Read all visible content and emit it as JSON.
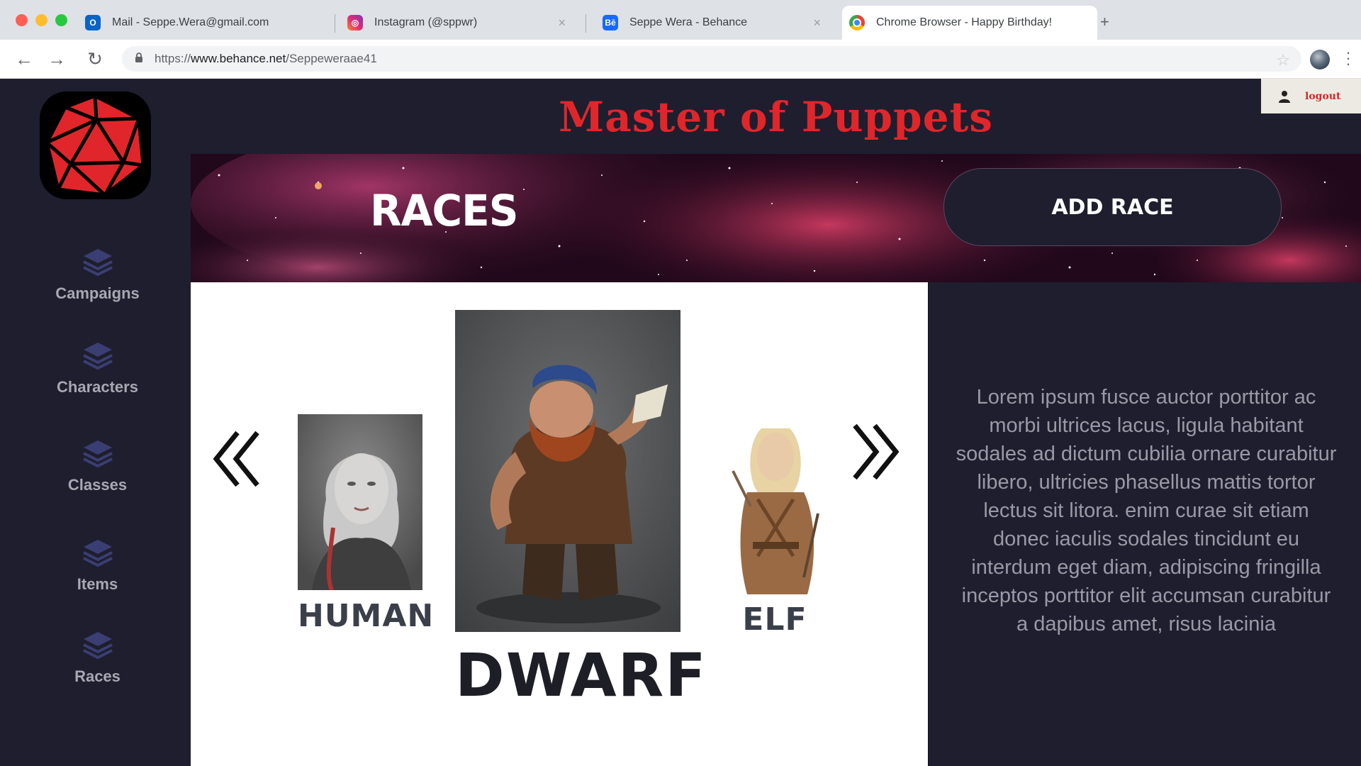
{
  "browser": {
    "tabs": [
      {
        "label": "Mail - Seppe.Wera@gmail.com",
        "icon": "outlook-icon",
        "active": false
      },
      {
        "label": "Instagram (@sppwr)",
        "icon": "instagram-icon",
        "active": false
      },
      {
        "label": "Seppe Wera - Behance",
        "icon": "behance-icon",
        "active": false
      },
      {
        "label": "Chrome Browser - Happy Birthday!",
        "icon": "chrome-icon",
        "active": true
      }
    ],
    "url": {
      "scheme": "https://",
      "domain": "www.behance.net",
      "path": "/Seppeweraae41"
    }
  },
  "app": {
    "title": "Master of Puppets",
    "logout_label": "logout",
    "sidebar": {
      "items": [
        {
          "label": "Campaigns",
          "icon": "stack-icon"
        },
        {
          "label": "Characters",
          "icon": "stack-icon"
        },
        {
          "label": "Classes",
          "icon": "stack-icon"
        },
        {
          "label": "Items",
          "icon": "stack-icon"
        },
        {
          "label": "Races",
          "icon": "stack-icon"
        }
      ]
    },
    "banner": {
      "title": "RACES",
      "add_button": "ADD RACE"
    },
    "carousel": {
      "prev_icon": "double-chevron-left-icon",
      "next_icon": "double-chevron-right-icon",
      "left": {
        "label": "HUMAN"
      },
      "center": {
        "label": "DWARF"
      },
      "right": {
        "label": "ELF"
      }
    },
    "description": "Lorem ipsum fusce auctor porttitor ac morbi ultrices lacus, ligula habitant sodales ad dictum cubilia ornare curabitur libero, ultricies phasellus mattis tortor lectus sit litora. enim curae sit etiam donec iaculis sodales tincidunt eu interdum eget diam, adipiscing fringilla inceptos porttitor elit accumsan curabitur a dapibus amet, risus lacinia"
  },
  "colors": {
    "accent": "#e0262a",
    "panel": "#1e1e2e",
    "sidebar_icon": "#3b3e73"
  }
}
